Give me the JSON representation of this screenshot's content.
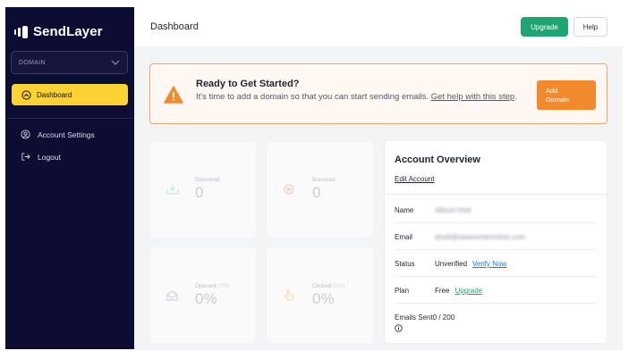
{
  "sidebar": {
    "brand": "SendLayer",
    "domain_select": "DOMAIN",
    "nav": {
      "dashboard": "Dashboard",
      "account_settings": "Account Settings",
      "logout": "Logout"
    }
  },
  "header": {
    "title": "Dashboard",
    "upgrade_label": "Upgrade",
    "help_label": "Help"
  },
  "alert": {
    "title": "Ready to Get Started?",
    "text": "It's time to add a domain so that you can start sending emails.",
    "link": "Get help with this step",
    "period": ".",
    "button_line1": "Add",
    "button_line2": "Domain"
  },
  "stats": {
    "delivered": {
      "label": "Delivered",
      "value": "0"
    },
    "bounced": {
      "label": "Bounced",
      "value": "0"
    },
    "opened": {
      "label": "Opened",
      "sub": "(0/0)",
      "value": "0%"
    },
    "clicked": {
      "label": "Clicked",
      "sub": "(0/0)",
      "value": "0%"
    }
  },
  "overview": {
    "title": "Account Overview",
    "edit_link": "Edit Account",
    "rows": {
      "name": {
        "label": "Name",
        "value": "Allison Hott"
      },
      "email": {
        "label": "Email",
        "value": "ahott@awesomemotive.com"
      },
      "status": {
        "label": "Status",
        "value": "Unverified",
        "link": "Verify Now"
      },
      "plan": {
        "label": "Plan",
        "value": "Free",
        "link": "Upgrade"
      }
    },
    "emails_sent": {
      "label": "Emails Sent",
      "value": "0 / 200"
    }
  },
  "colors": {
    "sidebar_bg": "#0d0d33",
    "nav_active": "#fbd233",
    "upgrade_green": "#1fa572",
    "alert_orange": "#f08a2c",
    "link_blue": "#1a7dd8"
  },
  "icons": {
    "brand": "sendlayer-logo-icon",
    "dashboard": "dashboard-icon",
    "account_settings": "user-circle-icon",
    "logout": "logout-icon",
    "alert": "warning-triangle-icon",
    "delivered": "inbox-download-icon",
    "bounced": "x-circle-icon",
    "opened": "envelope-open-icon",
    "clicked": "pointer-hand-icon",
    "emails_sent_info": "info-icon"
  }
}
